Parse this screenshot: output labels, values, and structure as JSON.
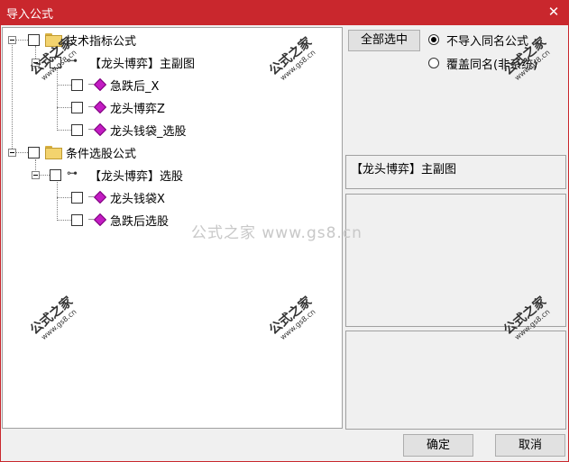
{
  "window": {
    "title": "导入公式",
    "close_label": "✕"
  },
  "tree": {
    "groups": [
      {
        "label": "技术指标公式",
        "children": [
          {
            "label": "【龙头博弈】主副图",
            "children": [
              {
                "label": "急跌后_X"
              },
              {
                "label": "龙头博弈Z"
              },
              {
                "label": "龙头钱袋_选股"
              }
            ]
          }
        ]
      },
      {
        "label": "条件选股公式",
        "children": [
          {
            "label": "【龙头博弈】选股",
            "children": [
              {
                "label": "龙头钱袋X"
              },
              {
                "label": "急跌后选股"
              }
            ]
          }
        ]
      }
    ]
  },
  "options": {
    "select_all_label": "全部选中",
    "radio_no_import_label": "不导入同名公式",
    "radio_overwrite_label": "覆盖同名(非系统)",
    "selected_option": "不导入同名公式"
  },
  "info": {
    "name_text": "【龙头博弈】主副图"
  },
  "buttons": {
    "ok_label": "确定",
    "cancel_label": "取消"
  },
  "watermark": {
    "center_text": "公式之家 www.gs8.cn",
    "stamp_big": "公式之家",
    "stamp_small": "www.gs8.cn"
  }
}
